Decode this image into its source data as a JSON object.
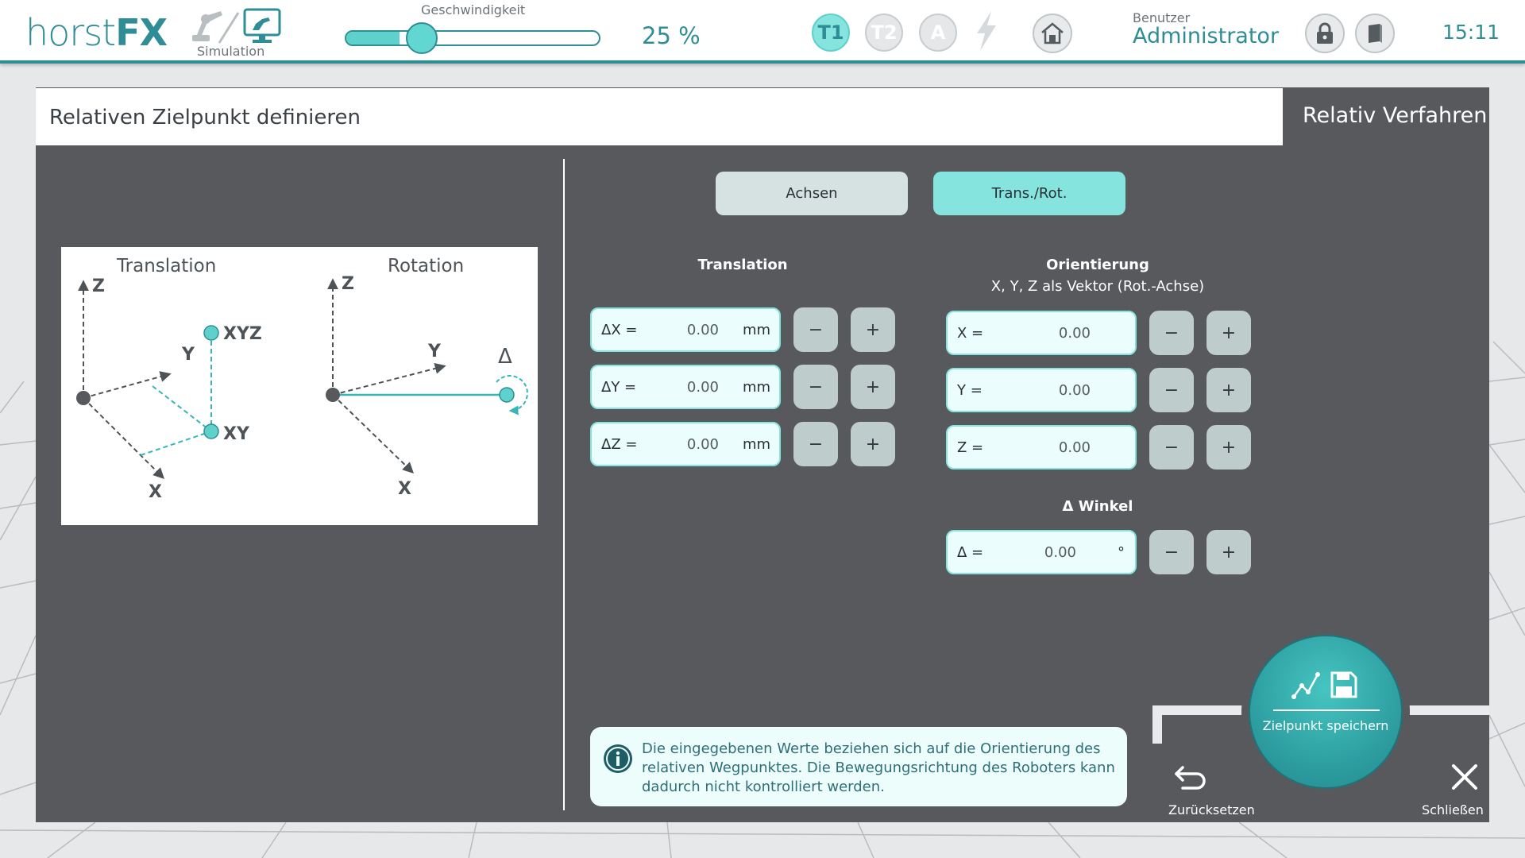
{
  "app": {
    "logo_light": "horst",
    "logo_bold": "FX",
    "mode_label": "Simulation"
  },
  "topbar": {
    "speed_label": "Geschwindigkeit",
    "speed_value": "25 %",
    "speed_level": 0.21,
    "modes": [
      "T1",
      "T2",
      "A"
    ],
    "active_mode": "T1",
    "user_label": "Benutzer",
    "user_name": "Administrator",
    "clock": "15:11",
    "icons": [
      "robot-simulation-icon",
      "bolt-icon",
      "home-icon",
      "lock-icon",
      "book-icon"
    ]
  },
  "panel": {
    "title": "Relativen Zielpunkt definieren",
    "tab": "Relativ Verfahren"
  },
  "diagram": {
    "translation_title": "Translation",
    "rotation_title": "Rotation",
    "axis_z": "Z",
    "axis_y": "Y",
    "axis_x": "X",
    "point_xyz": "XYZ",
    "point_xy": "XY",
    "delta": "Δ"
  },
  "tabs": {
    "axes": "Achsen",
    "transrot": "Trans./Rot."
  },
  "translation": {
    "title": "Translation",
    "rows": [
      {
        "label": "ΔX =",
        "value": "0.00",
        "unit": "mm"
      },
      {
        "label": "ΔY =",
        "value": "0.00",
        "unit": "mm"
      },
      {
        "label": "ΔZ =",
        "value": "0.00",
        "unit": "mm"
      }
    ]
  },
  "orientation": {
    "title": "Orientierung",
    "subtitle": "X, Y, Z als Vektor (Rot.-Achse)",
    "rows": [
      {
        "label": "X =",
        "value": "0.00"
      },
      {
        "label": "Y =",
        "value": "0.00"
      },
      {
        "label": "Z =",
        "value": "0.00"
      }
    ]
  },
  "angle": {
    "title": "Δ Winkel",
    "label": "Δ =",
    "value": "0.00",
    "unit": "°"
  },
  "buttons": {
    "minus": "−",
    "plus": "+",
    "save": "Zielpunkt speichern",
    "reset": "Zurücksetzen",
    "close": "Schließen"
  },
  "info": {
    "text": "Die eingegebenen Werte beziehen sich auf die Orientierung des relativen Wegpunktes. Die Bewegungsrichtung des Roboters kann dadurch nicht kontrolliert werden."
  },
  "colors": {
    "accent": "#2f8e95",
    "accent_light": "#86e4df",
    "panel": "#58595d"
  }
}
